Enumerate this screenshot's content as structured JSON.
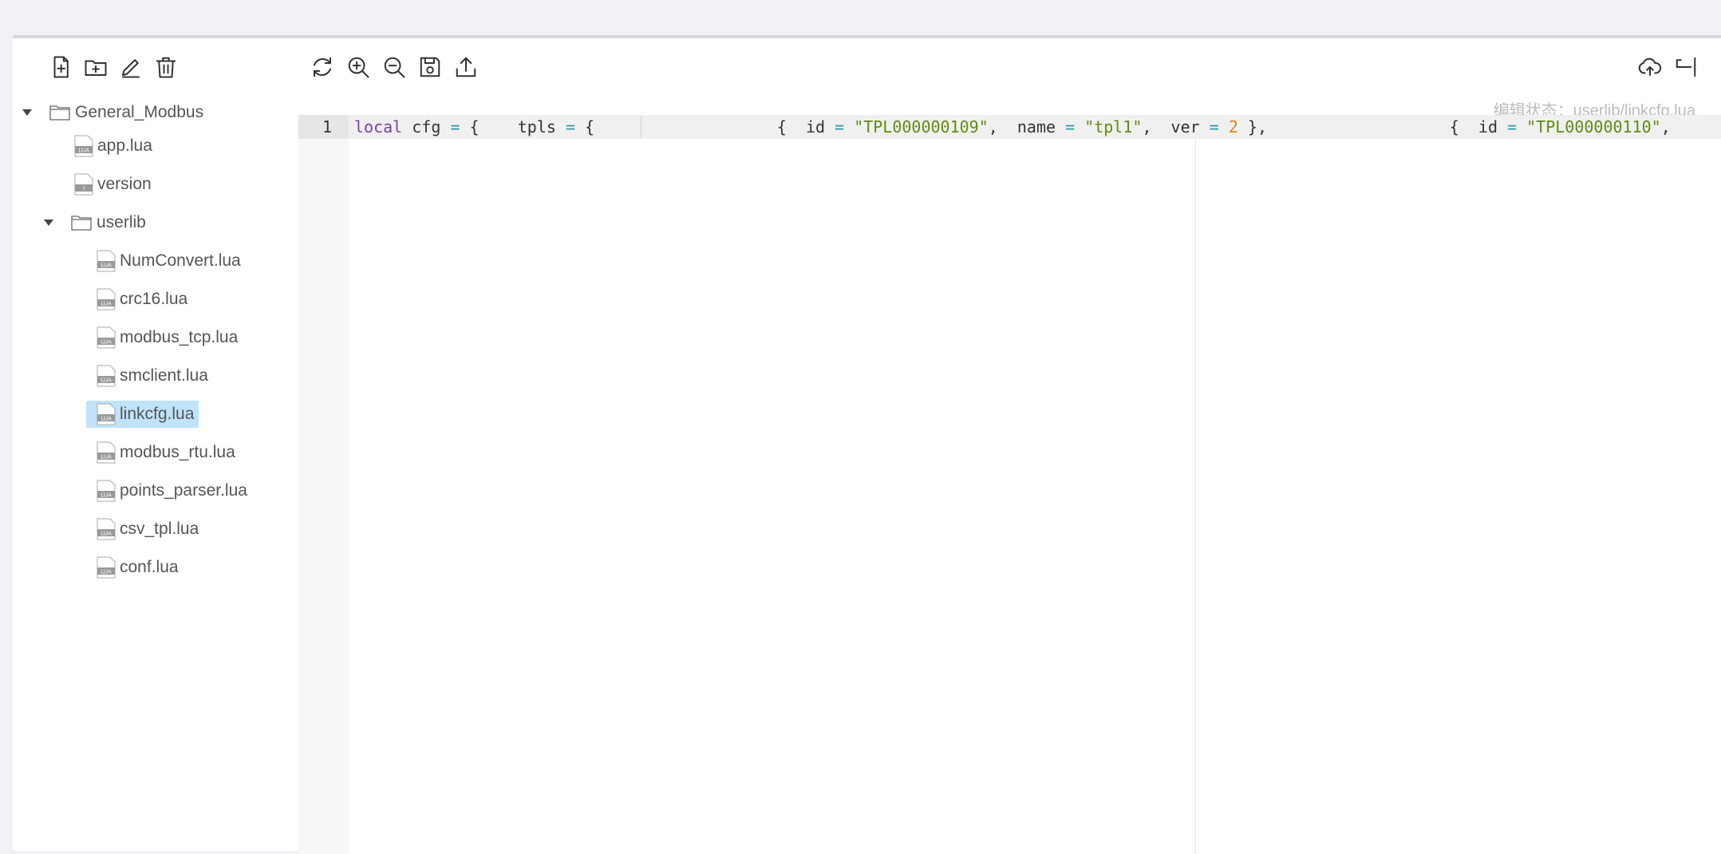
{
  "toolbar_left": {
    "icons": [
      "new-file-icon",
      "new-folder-icon",
      "rename-icon",
      "delete-icon"
    ]
  },
  "toolbar_editor": {
    "icons": [
      "refresh-icon",
      "zoom-in-icon",
      "zoom-out-icon",
      "save-icon",
      "export-icon"
    ]
  },
  "toolbar_right": {
    "icons": [
      "upload-cloud-icon",
      "exit-icon"
    ]
  },
  "status": {
    "text": "编辑状态：userlib/linkcfg.lua"
  },
  "tree": {
    "root": "General_Modbus",
    "root_files": [
      "app.lua",
      "version"
    ],
    "folder": "userlib",
    "folder_files": [
      "NumConvert.lua",
      "crc16.lua",
      "modbus_tcp.lua",
      "smclient.lua",
      "linkcfg.lua",
      "modbus_rtu.lua",
      "points_parser.lua",
      "csv_tpl.lua",
      "conf.lua"
    ],
    "selected": "linkcfg.lua"
  },
  "editor": {
    "line_number": "1",
    "tokens": {
      "t1": "local",
      "t2": " cfg ",
      "t3": "=",
      "t4": " {    tpls ",
      "t5": "=",
      "t6": " {                   {  id ",
      "t7": "=",
      "t8": " ",
      "t9": "\"TPL000000109\"",
      "t10": ",  name ",
      "t11": "=",
      "t12": " ",
      "t13": "\"tpl1\"",
      "t14": ",  ver ",
      "t15": "=",
      "t16": " ",
      "t17": "2",
      "t18": " },                   {  id ",
      "t19": "=",
      "t20": " ",
      "t21": "\"TPL000000110\"",
      "t22": ","
    }
  }
}
